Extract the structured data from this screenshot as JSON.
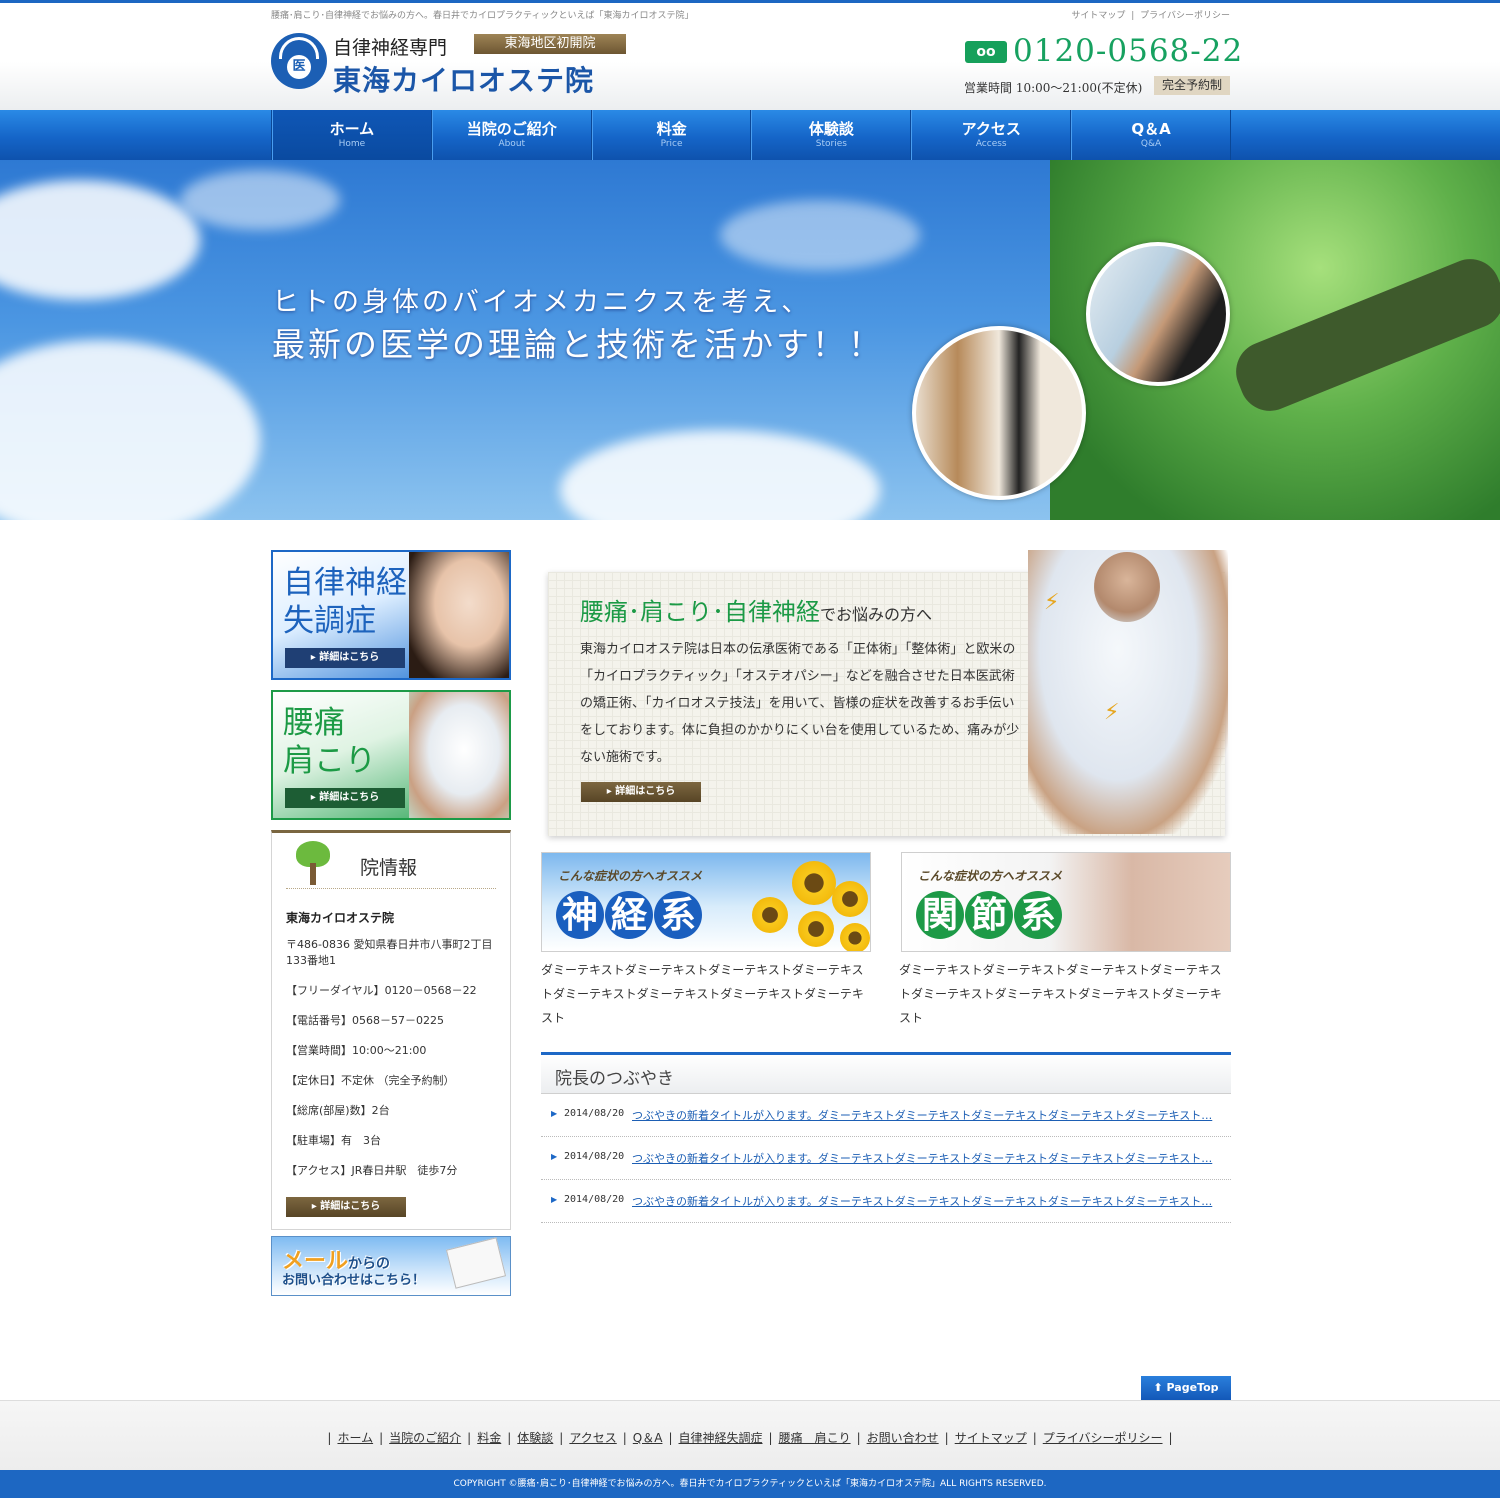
{
  "header": {
    "tagline": "腰痛･肩こり･自律神経でお悩みの方へ。春日井でカイロプラクティックといえば「東海カイロオステ院」",
    "util_links": [
      "サイトマップ",
      "|",
      "プライバシーポリシー"
    ],
    "logo_kanji": "医",
    "logo_sub": "自律神経専門",
    "logo_badge": "東海地区初開院",
    "logo_main": "東海カイロオステ院",
    "tel_icon": "oo",
    "tel_number": "0120-0568-22",
    "hours": "営業時間 10:00～21:00(不定休)",
    "reserve": "完全予約制"
  },
  "nav": [
    {
      "jp": "ホーム",
      "en": "Home"
    },
    {
      "jp": "当院のご紹介",
      "en": "About"
    },
    {
      "jp": "料金",
      "en": "Price"
    },
    {
      "jp": "体験談",
      "en": "Stories"
    },
    {
      "jp": "アクセス",
      "en": "Access"
    },
    {
      "jp": "Q＆A",
      "en": "Q&A"
    }
  ],
  "hero": {
    "line1": "ヒトの身体のバイオメカニクスを考え、",
    "line2": "最新の医学の理論と技術を活かす！！"
  },
  "sidebar": {
    "banner1": {
      "line1": "自律神経",
      "line2": "失調症",
      "button": "▸ 詳細はこちら"
    },
    "banner2": {
      "line1": "腰痛",
      "line2": "肩こり",
      "button": "▸ 詳細はこちら"
    },
    "info": {
      "title": "院情報",
      "name": "東海カイロオステ院",
      "lines": [
        "〒486-0836 愛知県春日井市八事町2丁目133番地1",
        "【フリーダイヤル】0120－0568－22",
        "【電話番号】0568－57－0225",
        "【営業時間】10:00～21:00",
        "【定休日】不定休 （完全予約制）",
        "【総席(部屋)数】2台",
        "【駐車場】有　3台",
        "【アクセス】JR春日井駅　徒歩7分"
      ],
      "button": "▸ 詳細はこちら"
    },
    "mail": {
      "line1a": "メール",
      "line1b": "からの",
      "line2": "お問い合わせはこちら！"
    }
  },
  "intro": {
    "heading": "腰痛･肩こり･自律神経",
    "heading_small": "でお悩みの方へ",
    "text": "東海カイロオステ院は日本の伝承医術である「正体術」「整体術」と欧米の「カイロプラクティック」「オステオパシー」などを融合させた日本医武術の矯正術、「カイロオステ技法」を用いて、皆様の症状を改善するお手伝いをしております。体に負担のかかりにくい台を使用しているため、痛みが少ない施術です。",
    "button": "▸ 詳細はこちら"
  },
  "cards": [
    {
      "eyebrow": "こんな症状の方へオススメ",
      "chars": [
        "神",
        "経",
        "系"
      ],
      "text": "ダミーテキストダミーテキストダミーテキストダミーテキストダミーテキストダミーテキストダミーテキストダミーテキスト"
    },
    {
      "eyebrow": "こんな症状の方へオススメ",
      "chars": [
        "関",
        "節",
        "系"
      ],
      "text": "ダミーテキストダミーテキストダミーテキストダミーテキストダミーテキストダミーテキストダミーテキストダミーテキスト"
    }
  ],
  "blog": {
    "title": "院長のつぶやき",
    "items": [
      {
        "date": "2014/08/20",
        "title": "つぶやきの新着タイトルが入ります。ダミーテキストダミーテキストダミーテキストダミーテキストダミーテキスト…"
      },
      {
        "date": "2014/08/20",
        "title": "つぶやきの新着タイトルが入ります。ダミーテキストダミーテキストダミーテキストダミーテキストダミーテキスト…"
      },
      {
        "date": "2014/08/20",
        "title": "つぶやきの新着タイトルが入ります。ダミーテキストダミーテキストダミーテキストダミーテキストダミーテキスト…"
      }
    ]
  },
  "footer": {
    "pagetop": "⬆ PageTop",
    "links": [
      "ホーム",
      "当院のご紹介",
      "料金",
      "体験談",
      "アクセス",
      "Q＆A",
      "自律神経失調症",
      "腰痛　肩こり",
      "お問い合わせ",
      "サイトマップ",
      "プライバシーポリシー"
    ],
    "copyright": "COPYRIGHT ©腰痛･肩こり･自律神経でお悩みの方へ。春日井でカイロプラクティックといえば「東海カイロオステ院」ALL RIGHTS RESERVED."
  },
  "colors": {
    "brand_blue": "#1d67c2",
    "brand_green": "#17a160",
    "accent_brown": "#6d5632"
  }
}
